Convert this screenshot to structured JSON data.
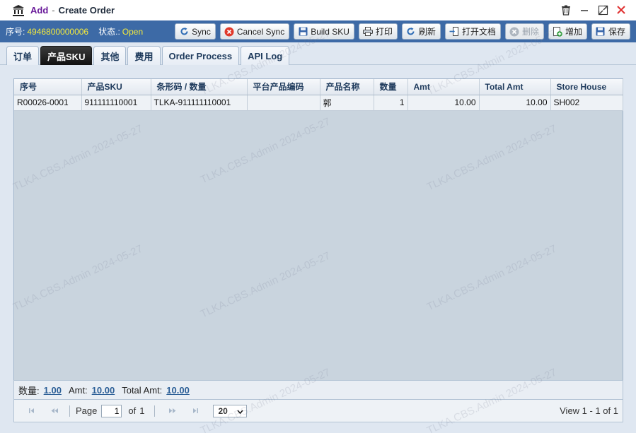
{
  "title": {
    "prefix": "Add",
    "sep": "-",
    "main": "Create Order"
  },
  "toolbar": {
    "seq_label": "序号:",
    "seq_value": "4946800000006",
    "status_label": "状态.:",
    "status_value": "Open",
    "buttons": {
      "sync": "Sync",
      "cancel_sync": "Cancel Sync",
      "build_sku": "Build SKU",
      "print": "打印",
      "refresh": "刷新",
      "open_doc": "打开文档",
      "delete": "删除",
      "add": "增加",
      "save": "保存"
    }
  },
  "tabs": [
    {
      "label": "订单",
      "active": false
    },
    {
      "label": "产品SKU",
      "active": true
    },
    {
      "label": "其他",
      "active": false
    },
    {
      "label": "费用",
      "active": false
    },
    {
      "label": "Order Process",
      "active": false
    },
    {
      "label": "API Log",
      "active": false
    }
  ],
  "grid": {
    "columns": [
      "序号",
      "产品SKU",
      "条形码 / 数量",
      "平台产品编码",
      "产品名称",
      "数量",
      "Amt",
      "Total Amt",
      "Store House"
    ],
    "rows": [
      [
        "R00026-0001",
        "911111110001",
        "TLKA-911111110001",
        "",
        "郭",
        "1",
        "10.00",
        "10.00",
        "SH002"
      ]
    ]
  },
  "summary": {
    "qty_label": "数量:",
    "qty_value": "1.00",
    "amt_label": "Amt:",
    "amt_value": "10.00",
    "total_label": "Total Amt:",
    "total_value": "10.00"
  },
  "pager": {
    "page_label": "Page",
    "current_page": "1",
    "of_label": "of",
    "total_pages": "1",
    "page_size": "20",
    "view_text": "View  1 - 1  of 1"
  },
  "watermark": "TLKA.CBS.Admin 2024-05-27",
  "colors": {
    "toolbar_bg": "#3d6aa6",
    "status_value": "#f4ea3c",
    "active_tab": "#111111"
  }
}
